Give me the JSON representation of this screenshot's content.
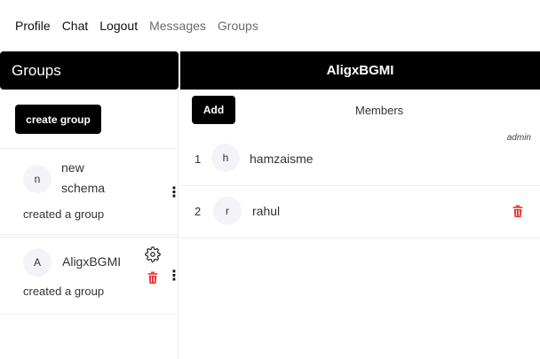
{
  "nav": {
    "items": [
      {
        "label": "Profile",
        "muted": false
      },
      {
        "label": "Chat",
        "muted": false
      },
      {
        "label": "Logout",
        "muted": false
      },
      {
        "label": "Messages",
        "muted": true
      },
      {
        "label": "Groups",
        "muted": true
      }
    ]
  },
  "sidebar": {
    "title": "Groups",
    "create_label": "create group",
    "groups": [
      {
        "avatar": "n",
        "name": "new schema",
        "subtitle": "created a group"
      },
      {
        "avatar": "A",
        "name": "AligxBGMI",
        "subtitle": "created a group"
      }
    ]
  },
  "chat": {
    "title": "AligxBGMI",
    "add_label": "Add",
    "members_label": "Members",
    "admin_label": "admin",
    "members": [
      {
        "index": "1",
        "avatar": "h",
        "name": "hamzaisme"
      },
      {
        "index": "2",
        "avatar": "r",
        "name": "rahul"
      }
    ]
  },
  "colors": {
    "header_bg": "#000000",
    "delete_red": "#e53935",
    "avatar_bg": "#f4f4f8"
  },
  "icons": {
    "settings": "gear-icon",
    "delete": "trash-icon",
    "more": "vertical-dots-icon"
  }
}
